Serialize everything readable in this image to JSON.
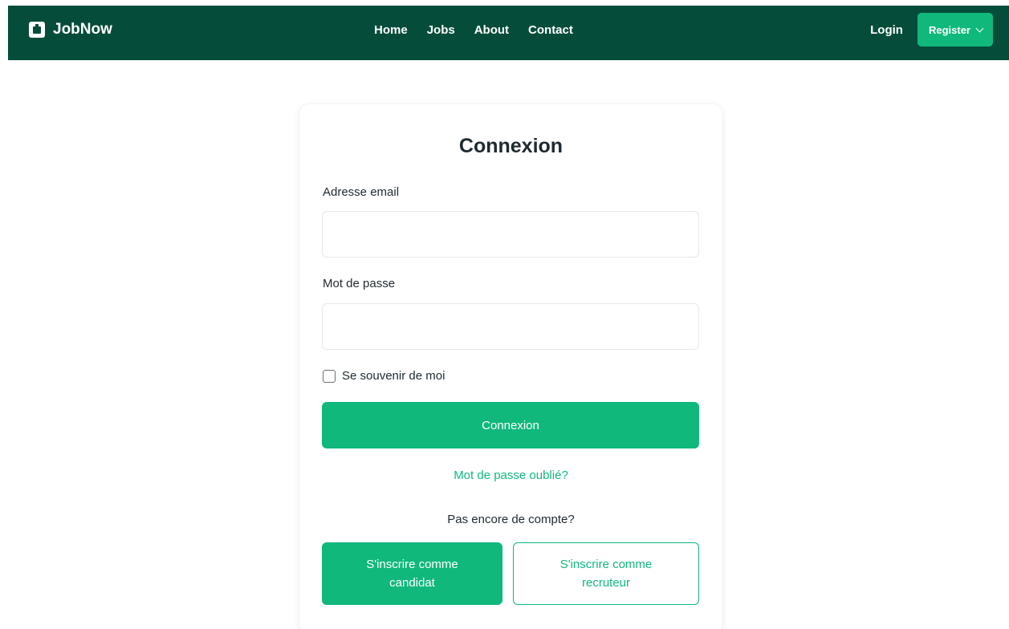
{
  "navbar": {
    "brand": "JobNow",
    "brand_icon": "briefcase-icon",
    "links": [
      "Home",
      "Jobs",
      "About",
      "Contact"
    ],
    "login_label": "Login",
    "register_label": "Register",
    "background_color": "#054d3a",
    "accent_color": "#10b87c"
  },
  "login_card": {
    "title": "Connexion",
    "email_label": "Adresse email",
    "email_value": "",
    "email_placeholder": "",
    "password_label": "Mot de passe",
    "password_value": "",
    "password_placeholder": "",
    "remember_label": "Se souvenir de moi",
    "remember_checked": false,
    "submit_label": "Connexion",
    "forgot_label": "Mot de passe oublié?",
    "no_account_text": "Pas encore de compte?",
    "register_candidate_line1": "S'inscrire comme",
    "register_candidate_line2": "candidat",
    "register_recruiter_line1": "S'inscrire comme",
    "register_recruiter_line2": "recruteur"
  }
}
